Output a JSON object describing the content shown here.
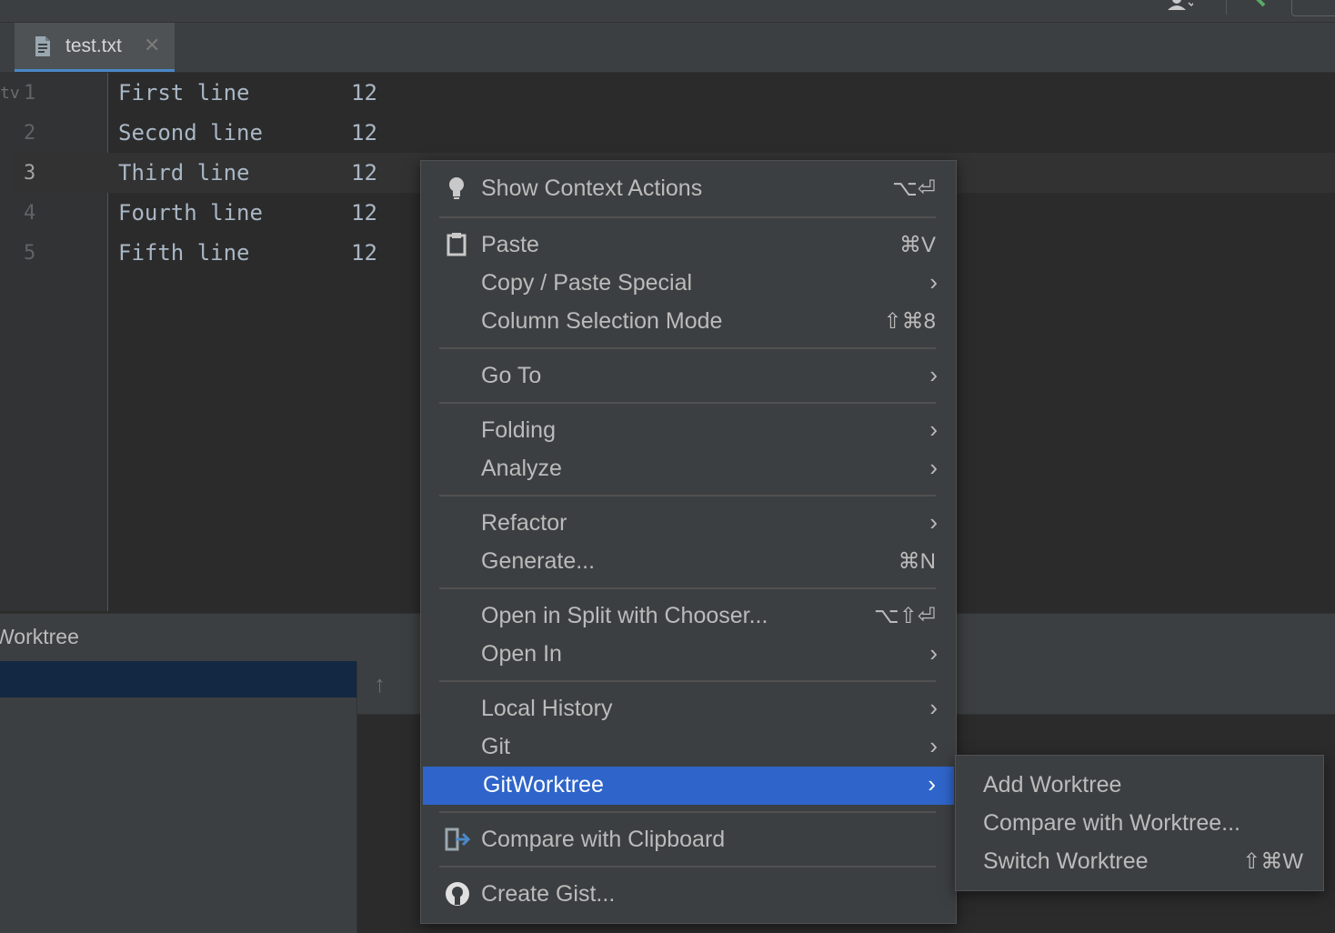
{
  "editor": {
    "tab": {
      "label": "test.txt",
      "close": "✕"
    },
    "gutter_mark": "tv",
    "lines": [
      {
        "num": "1",
        "text": "First line",
        "value": "12"
      },
      {
        "num": "2",
        "text": "Second line",
        "value": "12"
      },
      {
        "num": "3",
        "text": "Third line",
        "value": "12"
      },
      {
        "num": "4",
        "text": "Fourth line",
        "value": "12"
      },
      {
        "num": "5",
        "text": "Fifth line",
        "value": "12"
      }
    ]
  },
  "tool_window": {
    "title": "Worktree",
    "up_arrow": "↑"
  },
  "context_menu": {
    "items": [
      {
        "label": "Show Context Actions",
        "shortcut": "⌥⏎"
      },
      {
        "label": "Paste",
        "shortcut": "⌘V"
      },
      {
        "label": "Copy / Paste Special",
        "chevron": "›"
      },
      {
        "label": "Column Selection Mode",
        "shortcut": "⇧⌘8"
      },
      {
        "label": "Go To",
        "chevron": "›"
      },
      {
        "label": "Folding",
        "chevron": "›"
      },
      {
        "label": "Analyze",
        "chevron": "›"
      },
      {
        "label": "Refactor",
        "chevron": "›"
      },
      {
        "label": "Generate...",
        "shortcut": "⌘N"
      },
      {
        "label": "Open in Split with Chooser...",
        "shortcut": "⌥⇧⏎"
      },
      {
        "label": "Open In",
        "chevron": "›"
      },
      {
        "label": "Local History",
        "chevron": "›"
      },
      {
        "label": "Git",
        "chevron": "›"
      },
      {
        "label": "GitWorktree",
        "chevron": "›"
      },
      {
        "label": "Compare with Clipboard"
      },
      {
        "label": "Create Gist..."
      }
    ]
  },
  "submenu": {
    "items": [
      {
        "label": "Add Worktree"
      },
      {
        "label": "Compare with Worktree..."
      },
      {
        "label": "Switch Worktree",
        "shortcut": "⇧⌘W"
      }
    ]
  },
  "colors": {
    "accent": "#2f65ca",
    "background": "#2b2b2b",
    "menu": "#3c3f41",
    "text": "#bbbbbb"
  }
}
